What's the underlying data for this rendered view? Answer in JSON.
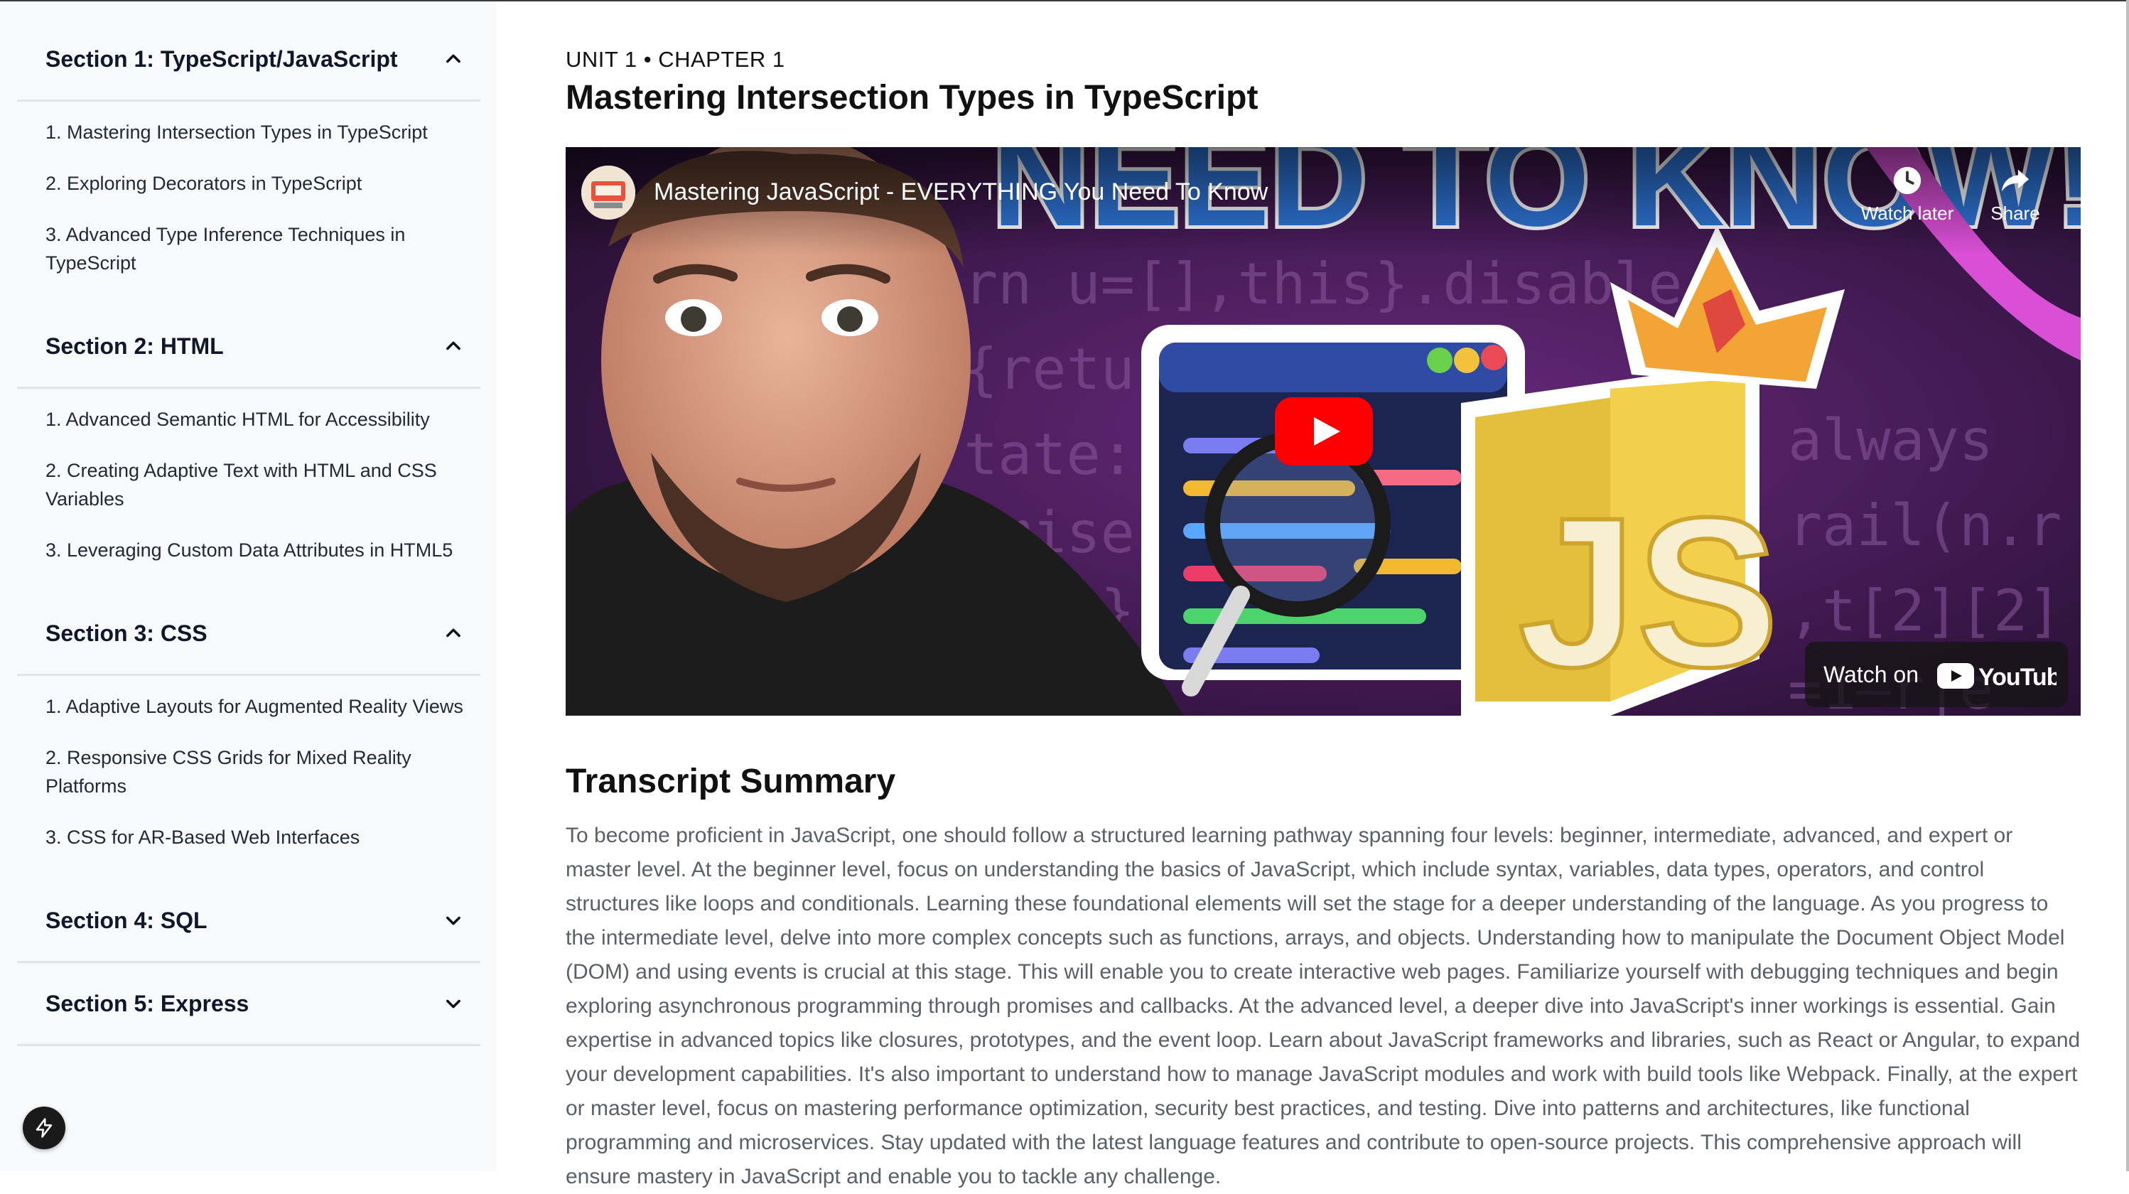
{
  "sidebar": {
    "sections": [
      {
        "title": "Section 1: TypeScript/JavaScript",
        "expanded": true,
        "lessons": [
          "1. Mastering Intersection Types in TypeScript",
          "2. Exploring Decorators in TypeScript",
          "3. Advanced Type Inference Techniques in TypeScript"
        ]
      },
      {
        "title": "Section 2: HTML",
        "expanded": true,
        "lessons": [
          "1. Advanced Semantic HTML for Accessibility",
          "2. Creating Adaptive Text with HTML and CSS Variables",
          "3. Leveraging Custom Data Attributes in HTML5"
        ]
      },
      {
        "title": "Section 3: CSS",
        "expanded": true,
        "lessons": [
          "1. Adaptive Layouts for Augmented Reality Views",
          "2. Responsive CSS Grids for Mixed Reality Platforms",
          "3. CSS for AR-Based Web Interfaces"
        ]
      },
      {
        "title": "Section 4: SQL",
        "expanded": false,
        "lessons": []
      },
      {
        "title": "Section 5: Express",
        "expanded": false,
        "lessons": []
      }
    ]
  },
  "main": {
    "breadcrumb": "UNIT 1 • CHAPTER 1",
    "title": "Mastering Intersection Types in TypeScript",
    "video": {
      "title": "Mastering JavaScript - EVERYTHING You Need To Know",
      "watch_later": "Watch later",
      "share": "Share",
      "watch_on": "Watch on",
      "youtube": "YouTube",
      "thumbnail_banner": "NEED TO KNOW!",
      "thumbnail_badge": "JS"
    },
    "summary_title": "Transcript Summary",
    "summary_text": "To become proficient in JavaScript, one should follow a structured learning pathway spanning four levels: beginner, intermediate, advanced, and expert or master level. At the beginner level, focus on understanding the basics of JavaScript, which include syntax, variables, data types, operators, and control structures like loops and conditionals. Learning these foundational elements will set the stage for a deeper understanding of the language. As you progress to the intermediate level, delve into more complex concepts such as functions, arrays, and objects. Understanding how to manipulate the Document Object Model (DOM) and using events is crucial at this stage. This will enable you to create interactive web pages. Familiarize yourself with debugging techniques and begin exploring asynchronous programming through promises and callbacks. At the advanced level, a deeper dive into JavaScript's inner workings is essential. Gain expertise in advanced topics like closures, prototypes, and the event loop. Learn about JavaScript frameworks and libraries, such as React or Angular, to expand your development capabilities. It's also important to understand how to manage JavaScript modules and work with build tools like Webpack. Finally, at the expert or master level, focus on mastering performance optimization, security best practices, and testing. Dive into patterns and architectures, like functional programming and microservices. Stay updated with the latest language features and contribute to open-source projects. This comprehensive approach will ensure mastery in JavaScript and enable you to tackle any challenge."
  },
  "icons": {
    "expand": "chevron-up-icon",
    "collapse": "chevron-down-icon",
    "floating": "lightning-bolt-icon",
    "watch_later": "clock-icon",
    "share": "share-arrow-icon",
    "play": "youtube-play-icon"
  },
  "colors": {
    "sidebar_bg": "#f8f9fb",
    "youtube_red": "#ff0000",
    "summary_text": "#5b5f66"
  }
}
